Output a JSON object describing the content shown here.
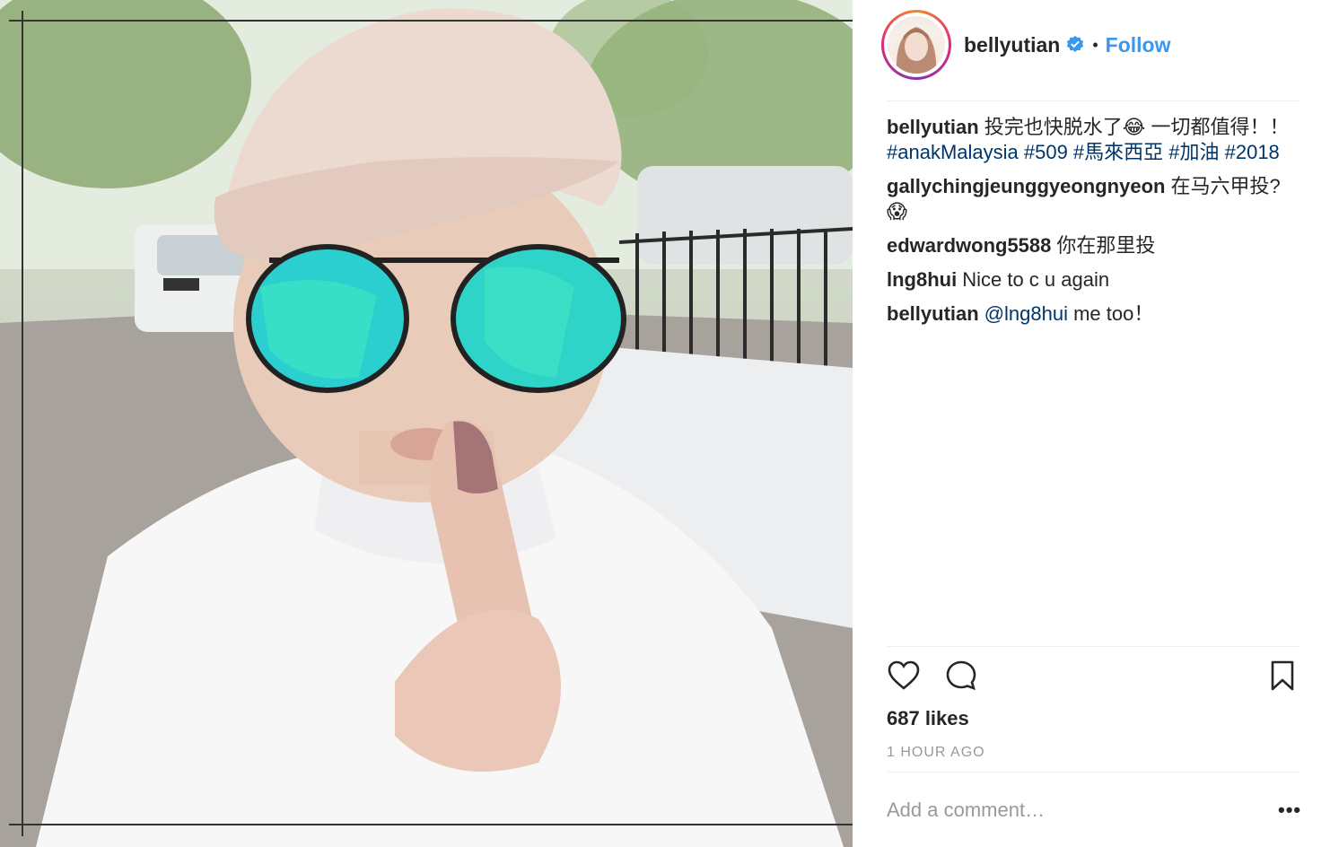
{
  "post": {
    "username": "bellyutian",
    "follow_label": "Follow",
    "separator": "•",
    "verified_icon": "verified-badge-icon",
    "photo_description_icon": "photo"
  },
  "comments": [
    {
      "user": "bellyutian",
      "text": "投完也快脱水了😂  一切都值得！！",
      "tags": "#anakMalaysia #509 #馬來西亞 #加油 #2018"
    },
    {
      "user": "gallychingjeunggyeongnyeon",
      "text": "在马六甲投?😱"
    },
    {
      "user": "edwardwong5588",
      "text": "你在那里投"
    },
    {
      "user": "lng8hui",
      "text": "Nice to c u again"
    },
    {
      "user": "bellyutian",
      "mention": "@lng8hui",
      "text": "me too！"
    }
  ],
  "likes": "687 likes",
  "time": "1 HOUR AGO",
  "add_comment_placeholder": "Add a comment…",
  "more_label": "•••",
  "colors": {
    "link": "#3897f0",
    "tag": "#003569",
    "muted": "#999999"
  }
}
